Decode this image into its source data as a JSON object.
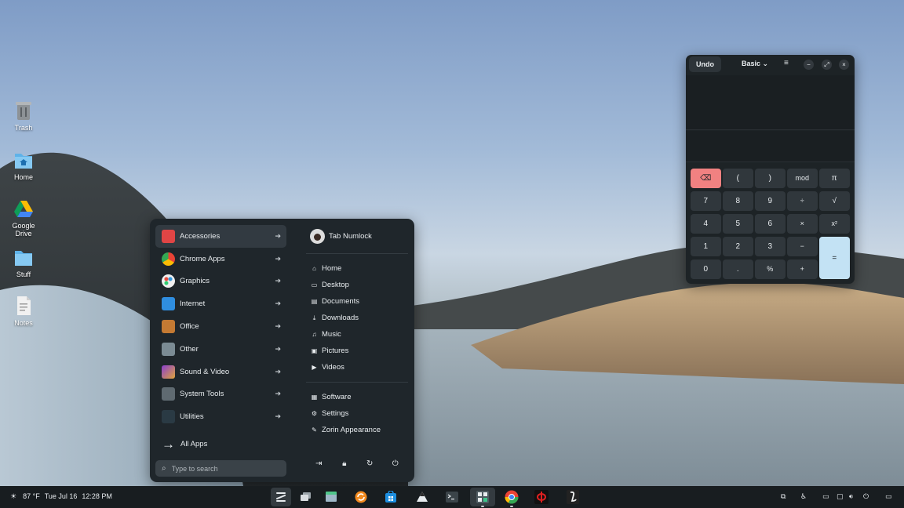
{
  "desktop": {
    "icons": [
      {
        "label": "Trash",
        "icon": "trash-icon"
      },
      {
        "label": "Home",
        "icon": "home-folder-icon"
      },
      {
        "label": "Google Drive",
        "icon": "google-drive-icon"
      },
      {
        "label": "Stuff",
        "icon": "folder-icon"
      },
      {
        "label": "Notes",
        "icon": "text-file-icon"
      }
    ]
  },
  "menu": {
    "categories": [
      {
        "label": "Accessories",
        "icon": "accessories-icon",
        "color": "#e04545"
      },
      {
        "label": "Chrome Apps",
        "icon": "chrome-icon",
        "color": "#4285f4"
      },
      {
        "label": "Graphics",
        "icon": "palette-icon",
        "color": "#f0f0f0"
      },
      {
        "label": "Internet",
        "icon": "cloud-icon",
        "color": "#2f8ee0"
      },
      {
        "label": "Office",
        "icon": "briefcase-icon",
        "color": "#c47a33"
      },
      {
        "label": "Other",
        "icon": "gear-icon",
        "color": "#7b8b94"
      },
      {
        "label": "Sound & Video",
        "icon": "media-icon",
        "color": "#8b3fd1"
      },
      {
        "label": "System Tools",
        "icon": "monitor-icon",
        "color": "#5f6a71"
      },
      {
        "label": "Utilities",
        "icon": "utilities-icon",
        "color": "#2a3a44"
      }
    ],
    "all_apps": "All Apps",
    "search_placeholder": "Type to search",
    "user": "Tab Numlock",
    "places": [
      {
        "label": "Home",
        "icon": "home-icon"
      },
      {
        "label": "Desktop",
        "icon": "desktop-icon"
      },
      {
        "label": "Documents",
        "icon": "document-icon"
      },
      {
        "label": "Downloads",
        "icon": "download-icon"
      },
      {
        "label": "Music",
        "icon": "music-icon"
      },
      {
        "label": "Pictures",
        "icon": "picture-icon"
      },
      {
        "label": "Videos",
        "icon": "video-icon"
      }
    ],
    "system": [
      {
        "label": "Software",
        "icon": "software-icon"
      },
      {
        "label": "Settings",
        "icon": "settings-icon"
      },
      {
        "label": "Zorin Appearance",
        "icon": "appearance-icon"
      }
    ],
    "power": [
      "logout-icon",
      "lock-icon",
      "restart-icon",
      "power-icon"
    ]
  },
  "calculator": {
    "undo": "Undo",
    "mode": "Basic",
    "keys": [
      [
        "⌫",
        "(",
        ")",
        "mod",
        "π"
      ],
      [
        "7",
        "8",
        "9",
        "÷",
        "√"
      ],
      [
        "4",
        "5",
        "6",
        "×",
        "x²"
      ],
      [
        "1",
        "2",
        "3",
        "−",
        "="
      ],
      [
        "0",
        ".",
        "%",
        "+",
        ""
      ]
    ]
  },
  "taskbar": {
    "temperature": "87 °F",
    "date": "Tue Jul 16",
    "time": "12:28 PM",
    "apps": [
      "zorin-menu-icon",
      "workspaces-icon",
      "files-icon",
      "software-updater-icon",
      "software-store-icon",
      "inkscape-icon",
      "terminal-icon",
      "calculator-icon",
      "chrome-icon",
      "phi-icon",
      "libreoffice-icon"
    ]
  },
  "colors": {
    "panel": "#1f262b",
    "accent_blue": "#c3e2f4",
    "backspace_red": "#f18181"
  }
}
